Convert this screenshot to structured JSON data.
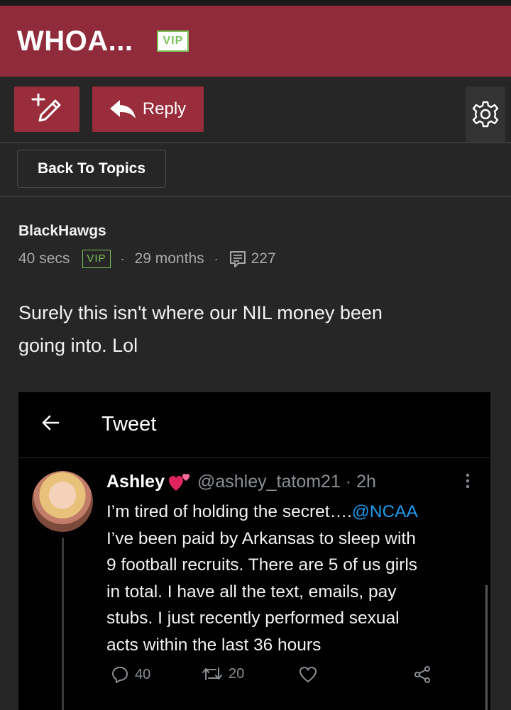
{
  "header": {
    "title": "WHOA...",
    "badge": "VIP"
  },
  "toolbar": {
    "reply_label": "Reply",
    "new_post_icon": "pencil-plus-icon",
    "settings_icon": "gear-icon"
  },
  "nav": {
    "back_label": "Back To Topics"
  },
  "post": {
    "author": "BlackHawgs",
    "time": "40 secs",
    "badge": "VIP",
    "tenure": "29 months",
    "post_count": "227",
    "dot": "·",
    "text_line1": "Surely this isn't where our NIL money been",
    "text_line2": "going into. Lol"
  },
  "tweet": {
    "header_title": "Tweet",
    "name": "Ashley",
    "handle_time": "@ashley_tatom21 · 2h",
    "line1_pre": "I’m tired of holding the secret….",
    "line1_mention": "@NCAA",
    "line2": "I’ve been paid by Arkansas to sleep with",
    "line3": "9 football recruits. There are 5 of us girls",
    "line4": "in total. I have all the text, emails, pay",
    "line5": "stubs. I just recently performed sexual",
    "line6": "acts within the last 36 hours",
    "replies": "40",
    "retweets": "20",
    "accent_color": "#1d9bf0"
  },
  "colors": {
    "brand": "#8f2b3a",
    "vip_green": "#7cc25a",
    "background": "#262626"
  }
}
